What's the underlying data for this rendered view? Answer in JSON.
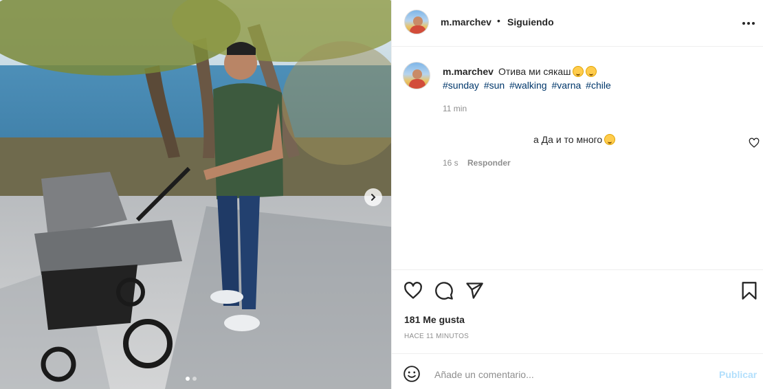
{
  "post": {
    "username": "m.marchev",
    "separator": "•",
    "follow_status": "Siguiendo",
    "caption_text": "Отива ми сякаш",
    "hashtags": [
      "#sunday",
      "#sun",
      "#walking",
      "#varna",
      "#chile"
    ],
    "caption_time": "11 min"
  },
  "reply": {
    "text": "а Да и то много",
    "time": "16 s",
    "reply_label": "Responder"
  },
  "stats": {
    "likes": "181 Me gusta",
    "posted_ago": "HACE 11 MINUTOS"
  },
  "composer": {
    "placeholder": "Añade un comentario...",
    "publish_label": "Publicar"
  },
  "icons": {
    "more": "more-options-icon",
    "like": "heart-icon",
    "comment": "comment-bubble-icon",
    "share": "paper-plane-icon",
    "save": "bookmark-icon",
    "emoji": "smiley-icon",
    "next": "chevron-right-icon"
  },
  "colors": {
    "link": "#00376b",
    "muted": "#8e8e8e",
    "publish_disabled": "#b2dffc",
    "text": "#262626"
  }
}
